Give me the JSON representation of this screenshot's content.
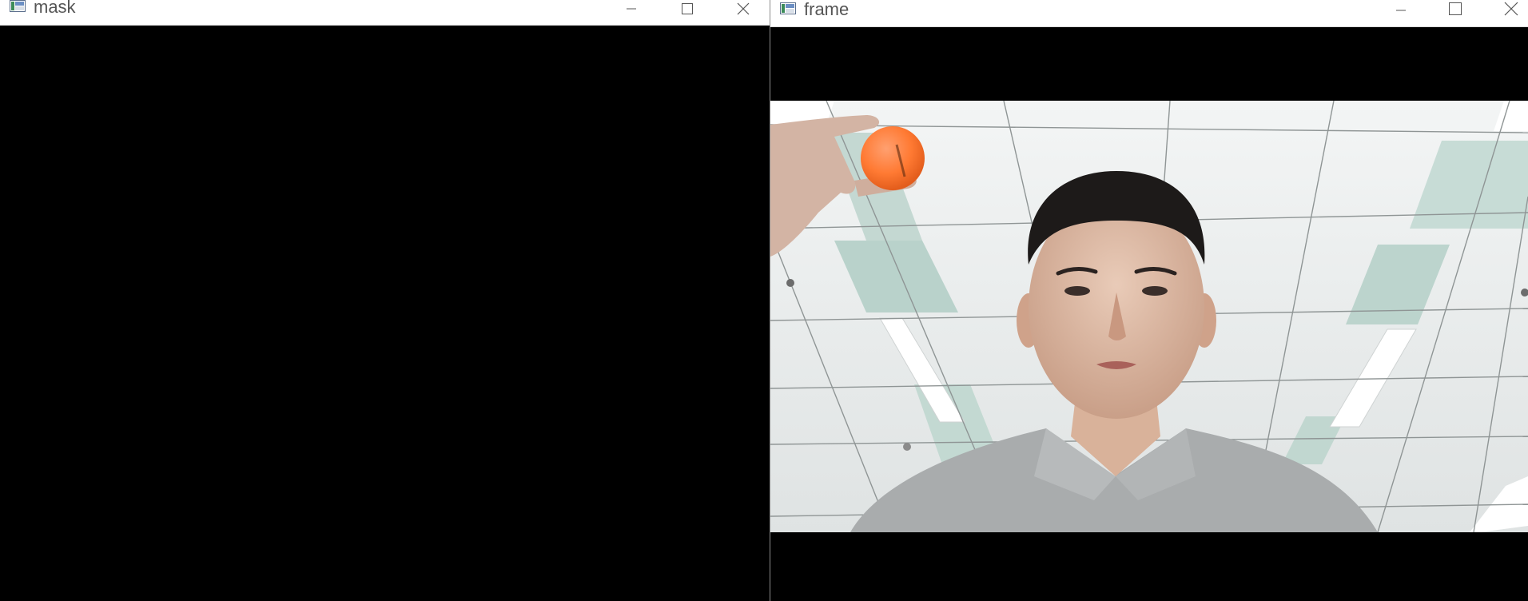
{
  "windows": {
    "mask": {
      "title": "mask"
    },
    "frame": {
      "title": "frame"
    }
  },
  "controls": {
    "minimize_icon": "minimize-icon",
    "maximize_icon": "maximize-icon",
    "close_icon": "close-icon"
  },
  "colors": {
    "ball": "#ff7a33",
    "shirt": "#a9acad",
    "ceiling": "#e7eaeb",
    "panel_green": "#bcd4cd"
  }
}
